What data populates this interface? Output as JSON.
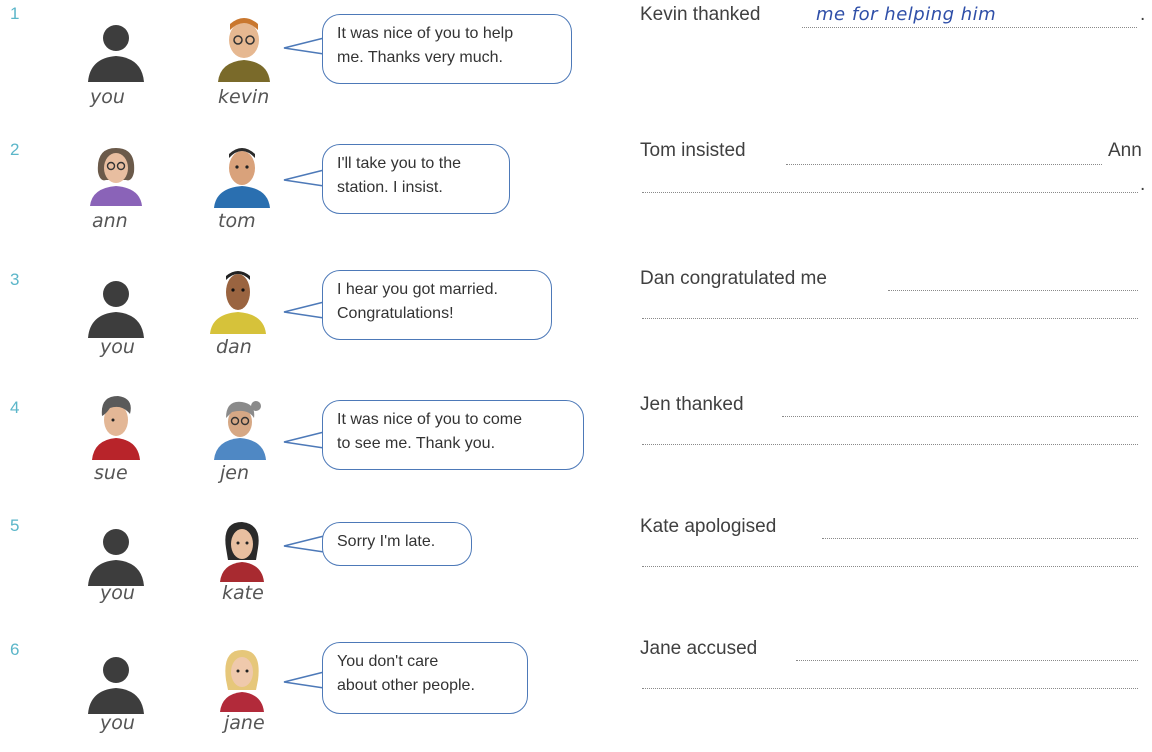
{
  "exercises": [
    {
      "number": "1",
      "speaker_left": "you",
      "speaker_right": "kevin",
      "speech": [
        "It was nice of you to help",
        "me.  Thanks very much."
      ],
      "sentence": "Kevin thanked",
      "answer": "me  for  helping  him",
      "end": "."
    },
    {
      "number": "2",
      "speaker_left": "ann",
      "speaker_right": "tom",
      "speech": [
        "I'll take you to the",
        "station.  I insist."
      ],
      "sentence": "Tom insisted",
      "end": "Ann"
    },
    {
      "number": "3",
      "speaker_left": "you",
      "speaker_right": "dan",
      "speech": [
        "I hear you got married.",
        "Congratulations!"
      ],
      "sentence": "Dan congratulated me"
    },
    {
      "number": "4",
      "speaker_left": "sue",
      "speaker_right": "jen",
      "speech": [
        "It was nice of you to come",
        "to see me.  Thank you."
      ],
      "sentence": "Jen thanked"
    },
    {
      "number": "5",
      "speaker_left": "you",
      "speaker_right": "kate",
      "speech": [
        "Sorry I'm late."
      ],
      "sentence": "Kate apologised"
    },
    {
      "number": "6",
      "speaker_left": "you",
      "speaker_right": "jane",
      "speech": [
        "You don't care",
        "about other people."
      ],
      "sentence": "Jane accused"
    }
  ],
  "icons": {
    "silhouette": "person-silhouette-icon",
    "portrait": "cartoon-portrait-icon"
  },
  "colors": {
    "number": "#5bb6c9",
    "bubble_border": "#4d79b8",
    "handwriting": "#2f4fa8",
    "silhouette": "#3d3d3d"
  }
}
